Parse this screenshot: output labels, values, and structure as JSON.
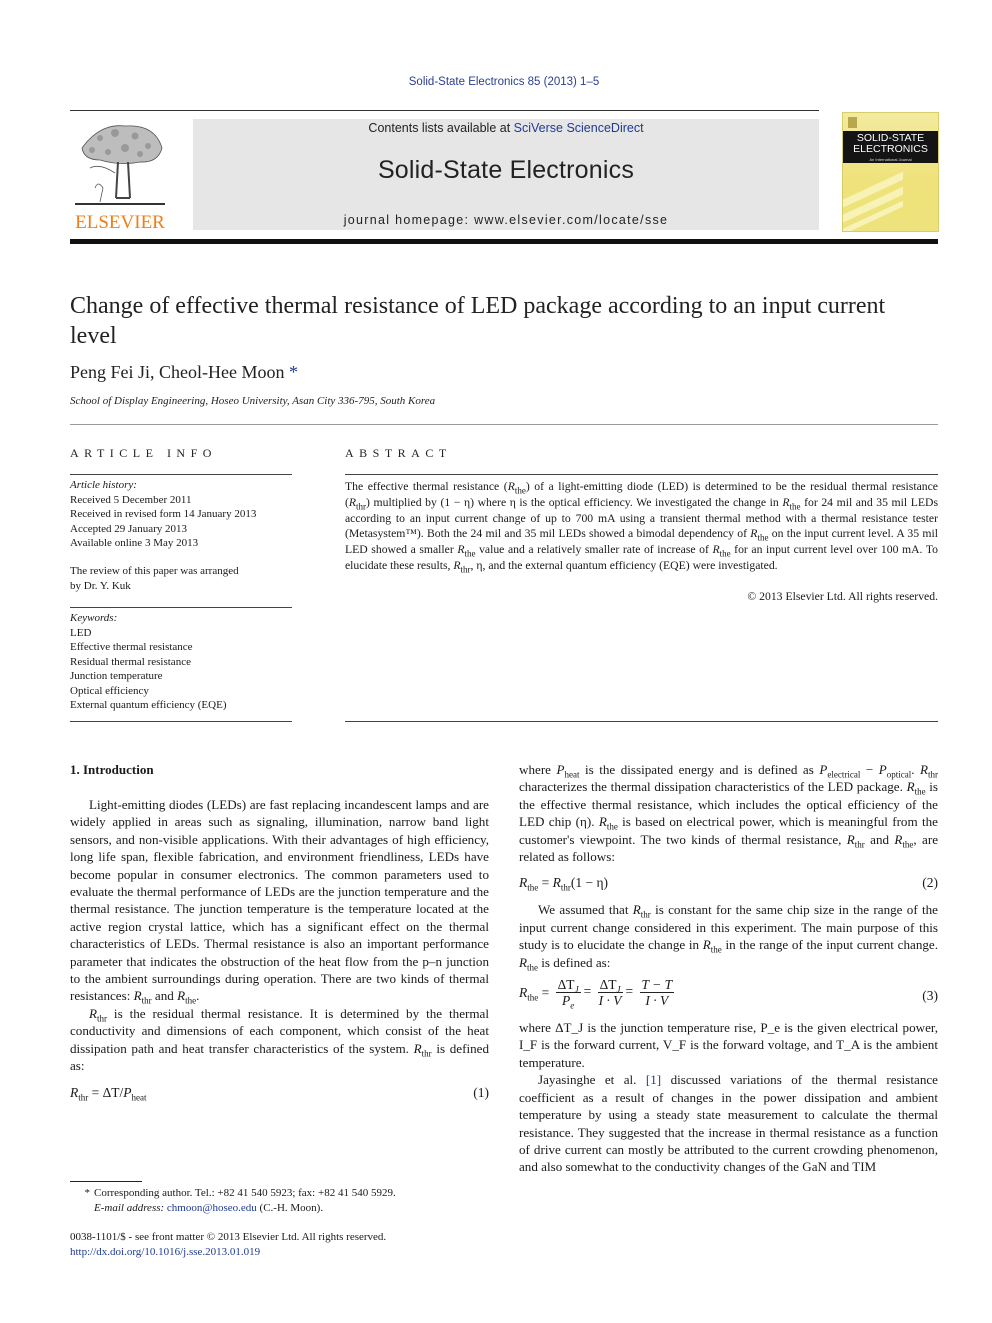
{
  "journal_ref": "Solid-State Electronics 85 (2013) 1–5",
  "header": {
    "publisher": "ELSEVIER",
    "contents_prefix": "Contents lists available at ",
    "contents_link": "SciVerse ScienceDirect",
    "journal_title": "Solid-State Electronics",
    "homepage": "journal homepage: www.elsevier.com/locate/sse",
    "cover_title_1": "SOLID-STATE",
    "cover_title_2": "ELECTRONICS",
    "cover_subtitle": "An International Journal"
  },
  "paper": {
    "title": "Change of effective thermal resistance of LED package according to an input current level",
    "authors": "Peng Fei Ji, Cheol-Hee Moon",
    "author_mark": "*",
    "affiliation": "School of Display Engineering, Hoseo University, Asan City 336-795, South Korea"
  },
  "article_info": {
    "heading": "ARTICLE INFO",
    "history_label": "Article history:",
    "history": [
      "Received 5 December 2011",
      "Received in revised form 14 January 2013",
      "Accepted 29 January 2013",
      "Available online 3 May 2013"
    ],
    "review_note_1": "The review of this paper was arranged",
    "review_note_2": "by Dr. Y. Kuk",
    "keywords_label": "Keywords:",
    "keywords": [
      "LED",
      "Effective thermal resistance",
      "Residual thermal resistance",
      "Junction temperature",
      "Optical efficiency",
      "External quantum efficiency (EQE)"
    ]
  },
  "abstract": {
    "heading": "ABSTRACT",
    "s1": "The effective thermal resistance (",
    "s2": ") of a light-emitting diode (LED) is determined to be the residual thermal resistance (",
    "s3": ") multiplied by (1 − η) where η is the optical efficiency. We investigated the change in ",
    "s4": " for 24 mil and 35 mil LEDs according to an input current change of up to 700 mA using a transient thermal method with a thermal resistance tester (Metasystem™). Both the 24 mil and 35 mil LEDs showed a bimodal dependency of ",
    "s5": " on the input current level. A 35 mil LED showed a smaller ",
    "s6": " value and a relatively smaller rate of increase of ",
    "s7": " for an input current level over 100 mA. To elucidate these results, ",
    "s8": ", η, and the external quantum efficiency (EQE) were investigated.",
    "copyright": "© 2013 Elsevier Ltd. All rights reserved."
  },
  "symbols": {
    "R": "R",
    "the": "the",
    "thr": "thr",
    "heat": "heat",
    "electrical": "electrical",
    "optical": "optical",
    "P": "P"
  },
  "intro": {
    "heading": "1. Introduction",
    "p1": "Light-emitting diodes (LEDs) are fast replacing incandescent lamps and are widely applied in areas such as signaling, illumination, narrow band light sensors, and non-visible applications. With their advantages of high efficiency, long life span, flexible fabrication, and environment friendliness, LEDs have become popular in consumer electronics. The common parameters used to evaluate the thermal performance of LEDs are the junction temperature and the thermal resistance. The junction temperature is the temperature located at the active region crystal lattice, which has a significant effect on the thermal characteristics of LEDs. Thermal resistance is also an important performance parameter that indicates the obstruction of the heat flow from the p–n junction to the ambient surroundings during operation. There are two kinds of thermal resistances: ",
    "p1_and": " and ",
    "p1_end": ".",
    "p2a": " is the residual thermal resistance. It is determined by the thermal conductivity and dimensions of each component, which consist of the heat dissipation path and heat transfer characteristics of the system. ",
    "p2b": " is defined as:",
    "eq1_rhs": " = ΔT/",
    "eq1_num": "(1)",
    "r1": "where ",
    "r1b": " is the dissipated energy and is defined as ",
    "r1c": " − ",
    "r1d": ". ",
    "r1e": " characterizes the thermal dissipation characteristics of the LED package. ",
    "r1f": " is the effective thermal resistance, which includes the optical efficiency of the LED chip (η). ",
    "r1g": " is based on electrical power, which is meaningful from the customer's viewpoint. The two kinds of thermal resistance, ",
    "r1h": " and ",
    "r1i": ", are related as follows:",
    "eq2_rhs": "(1 − η)",
    "eq2_num": "(2)",
    "r2a": "We assumed that ",
    "r2b": " is constant for the same chip size in the range of the input current change considered in this experiment. The main purpose of this study is to elucidate the change in ",
    "r2c": " in the range of the input current change. ",
    "r2d": " is defined as:",
    "eq3_num": "(3)",
    "eq3_f1_top": "ΔT",
    "eq3_f1_bot": "P",
    "eq3_f2_top": "ΔT",
    "eq3_f2_bot": "I · V",
    "eq3_f3_top": "T − T",
    "eq3_f3_bot": "I · V",
    "r3": "where ΔT_J is the junction temperature rise, P_e is the given electrical power, I_F is the forward current, V_F is the forward voltage, and T_A is the ambient temperature.",
    "r4a": "Jayasinghe et al. ",
    "r4_ref": "[1]",
    "r4b": " discussed variations of the thermal resistance coefficient as a result of changes in the power dissipation and ambient temperature by using a steady state measurement to calculate the thermal resistance. They suggested that the increase in thermal resistance as a function of drive current can mostly be attributed to the current crowding phenomenon, and also somewhat to the conductivity changes of the GaN and TIM"
  },
  "footnote": {
    "star": "*",
    "contact": "Corresponding author. Tel.: +82 41 540 5923; fax: +82 41 540 5929.",
    "email_label": "E-mail address: ",
    "email": "chmoon@hoseo.edu",
    "email_suffix": " (C.-H. Moon).",
    "issn": "0038-1101/$ - see front matter © 2013 Elsevier Ltd. All rights reserved.",
    "doi": "http://dx.doi.org/10.1016/j.sse.2013.01.019"
  },
  "colors": {
    "link": "#1f3a93",
    "elsevier_orange": "#f07d16",
    "header_gray": "#e6e6e6",
    "cover_yellow": "#efe27a"
  }
}
